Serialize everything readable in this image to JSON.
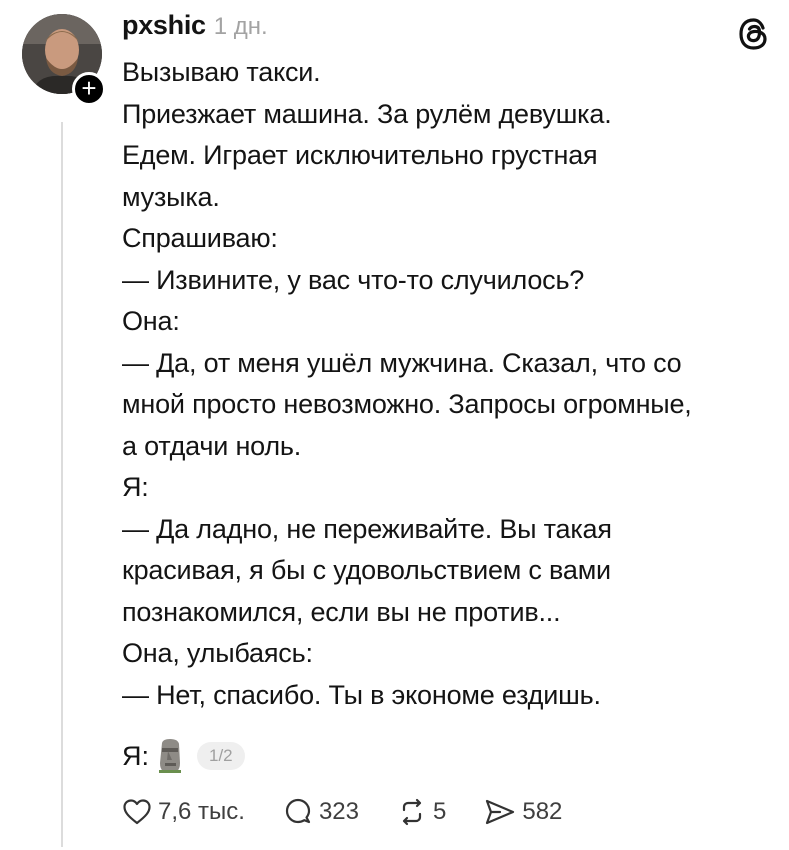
{
  "post": {
    "username": "pxshic",
    "time": "1 дн.",
    "lines": [
      "Вызываю такси.",
      "Приезжает машина. За рулём девушка.",
      "Едем. Играет исключительно грустная",
      "музыка.",
      "Спрашиваю:",
      "— Извините, у вас что-то случилось?",
      "Она:",
      "— Да, от меня ушёл мужчина. Сказал, что со",
      "мной просто невозможно. Запросы огромные,",
      "а отдачи ноль.",
      "Я:",
      "— Да ладно, не переживайте. Вы такая",
      "красивая, я бы с удовольствием с вами",
      "познакомился, если вы не против...",
      "Она, улыбаясь:",
      "— Нет, спасибо. Ты в экономе ездишь."
    ],
    "last_line_prefix": "Я:",
    "last_line_emoji": "moai-icon",
    "page_indicator": "1/2"
  },
  "actions": {
    "likes": "7,6 тыс.",
    "replies": "323",
    "reposts": "5",
    "shares": "582"
  },
  "icons": [
    "follow-plus-icon",
    "threads-logo-icon",
    "moai-icon",
    "heart-icon",
    "comment-icon",
    "repost-icon",
    "share-icon"
  ],
  "colors": {
    "text": "#141414",
    "muted": "#a3a3a3",
    "thread_line": "#dcdcdc"
  }
}
